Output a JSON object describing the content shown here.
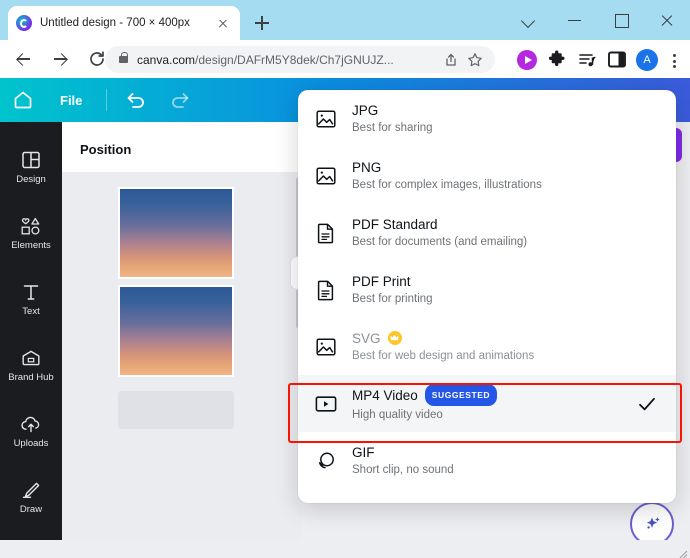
{
  "browser": {
    "tab": {
      "title": "Untitled design - 700 × 400px",
      "favicon_name": "canva-favicon",
      "close_label": "×"
    },
    "new_tab_label": "+",
    "window_controls": [
      "chevron-down",
      "minimize",
      "maximize",
      "close"
    ],
    "nav": {
      "back_label": "←",
      "forward_label": "→",
      "reload_label": "⟳"
    },
    "omnibox": {
      "url_host": "canva.com",
      "url_path": "/design/DAFrM5Y8dek/Ch7jGNUJZ...",
      "lock_icon": "lock-icon",
      "share_icon": "share-icon",
      "bookmark_icon": "star-icon"
    },
    "toolbar_icons": [
      "play-circle-icon",
      "extensions-puzzle-icon",
      "reading-list-icon",
      "side-panel-icon",
      "profile-avatar-icon",
      "chrome-menu-icon"
    ],
    "avatar_letter": "A"
  },
  "canva": {
    "topbar": {
      "home_icon": "home-icon",
      "file_label": "File",
      "undo_icon": "undo-arrow-icon",
      "redo_icon": "redo-arrow-icon"
    },
    "sidebar": {
      "items": [
        {
          "label": "Design",
          "icon": "layout-grid-icon"
        },
        {
          "label": "Elements",
          "icon": "shapes-icon"
        },
        {
          "label": "Text",
          "icon": "text-t-icon"
        },
        {
          "label": "Brand Hub",
          "icon": "brand-hub-icon"
        },
        {
          "label": "Uploads",
          "icon": "cloud-upload-icon"
        },
        {
          "label": "Draw",
          "icon": "pen-draw-icon"
        }
      ]
    },
    "panel": {
      "title": "Position",
      "thumbnails": 2,
      "placeholder_block": true
    },
    "magic_button_icon": "magic-sparkle-icon"
  },
  "export_menu": {
    "items": [
      {
        "title": "JPG",
        "subtitle": "Best for sharing",
        "icon": "image-icon",
        "badge": "",
        "crown": false,
        "selected": false,
        "dimmed": false,
        "checked": false
      },
      {
        "title": "PNG",
        "subtitle": "Best for complex images, illustrations",
        "icon": "image-icon",
        "badge": "",
        "crown": false,
        "selected": false,
        "dimmed": false,
        "checked": false
      },
      {
        "title": "PDF Standard",
        "subtitle": "Best for documents (and emailing)",
        "icon": "document-icon",
        "badge": "",
        "crown": false,
        "selected": false,
        "dimmed": false,
        "checked": false
      },
      {
        "title": "PDF Print",
        "subtitle": "Best for printing",
        "icon": "document-icon",
        "badge": "",
        "crown": false,
        "selected": false,
        "dimmed": false,
        "checked": false
      },
      {
        "title": "SVG",
        "subtitle": "Best for web design and animations",
        "icon": "image-icon",
        "badge": "",
        "crown": true,
        "selected": false,
        "dimmed": true,
        "checked": false
      },
      {
        "title": "MP4 Video",
        "subtitle": "High quality video",
        "icon": "video-icon",
        "badge": "SUGGESTED",
        "crown": false,
        "selected": true,
        "dimmed": false,
        "checked": true
      },
      {
        "title": "GIF",
        "subtitle": "Short clip, no sound",
        "icon": "gif-icon",
        "badge": "",
        "crown": false,
        "selected": false,
        "dimmed": false,
        "checked": false
      }
    ],
    "highlight": {
      "target": "MP4 Video",
      "color": "#fa1205"
    }
  },
  "colors": {
    "accent_purple": "#7d2ae8",
    "badge_blue": "#2457e6",
    "highlight_red": "#fa1205",
    "crown_yellow": "#ffc628",
    "sidebar_dark": "#1b1c20"
  }
}
